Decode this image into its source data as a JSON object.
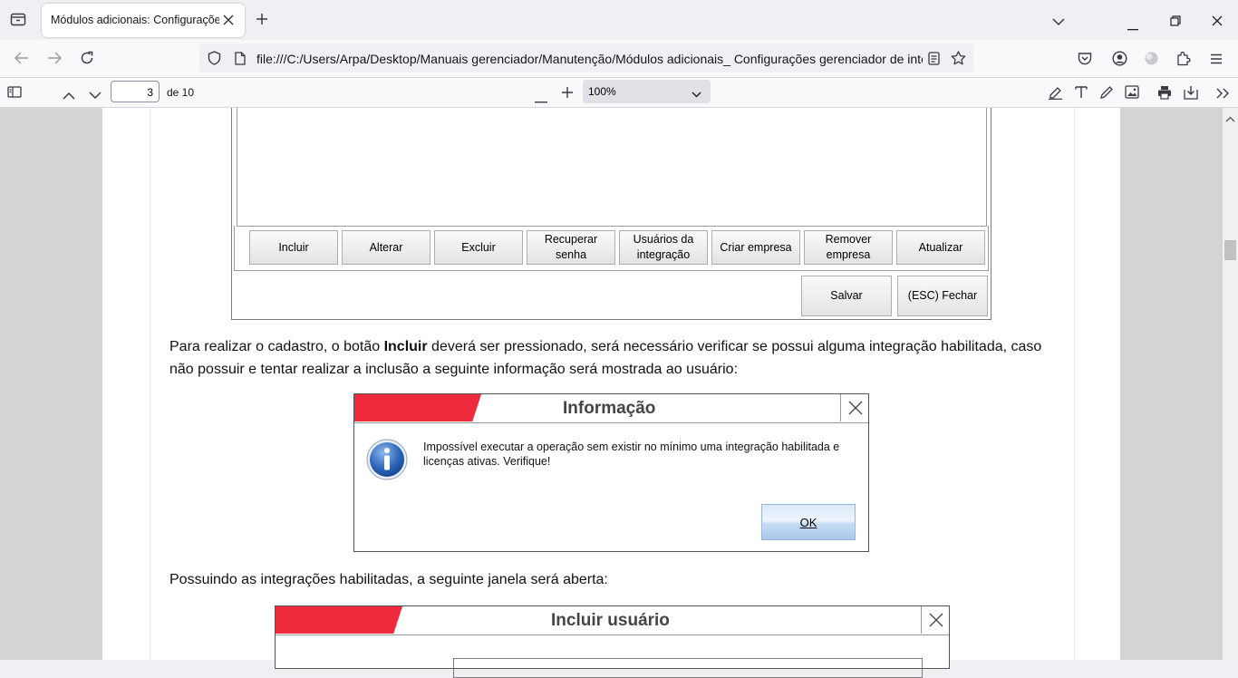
{
  "browser": {
    "tab_title": "Módulos adicionais: Configurações",
    "url": "file:///C:/Users/Arpa/Desktop/Manuais gerenciador/Manutenção/Módulos adicionais_ Configurações gerenciador de inte"
  },
  "pdf_toolbar": {
    "page_number": "3",
    "page_total": "de 10",
    "zoom": "100%"
  },
  "form": {
    "buttons": [
      {
        "line1": "Incluir",
        "line2": ""
      },
      {
        "line1": "Alterar",
        "line2": ""
      },
      {
        "line1": "Excluir",
        "line2": ""
      },
      {
        "line1": "Recuperar",
        "line2": "senha"
      },
      {
        "line1": "Usuários da",
        "line2": "integração"
      },
      {
        "line1": "Criar empresa",
        "line2": ""
      },
      {
        "line1": "Remover",
        "line2": "empresa"
      },
      {
        "line1": "Atualizar",
        "line2": ""
      }
    ],
    "save_label": "Salvar",
    "close_label": "(ESC) Fechar"
  },
  "content": {
    "para1_before": "Para realizar o cadastro, o botão ",
    "para1_bold": "Incluir",
    "para1_after": " deverá ser pressionado, será necessário verificar se possui alguma integração habilitada, caso não possuir e tentar realizar a inclusão a seguinte informação será mostrada ao usuário:",
    "para2": "Possuindo as integrações habilitadas, a seguinte janela será aberta:"
  },
  "info_dialog": {
    "title": "Informação",
    "message_line1": "Impossível executar a operação sem existir no mínimo uma integração habilitada e",
    "message_line2": "licenças ativas. Verifique!",
    "ok_label": "OK"
  },
  "user_dialog": {
    "title": "Incluir usuário"
  },
  "colors": {
    "dialog_red": "#ee2a3c",
    "info_blue": "#1f5fb3"
  }
}
